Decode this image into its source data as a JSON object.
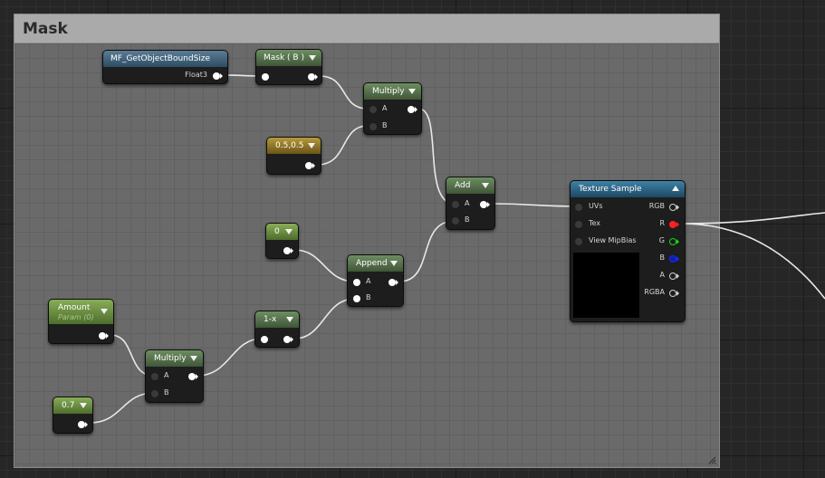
{
  "comment": {
    "title": "Mask"
  },
  "nodes": {
    "bound_size": {
      "title": "MF_GetObjectBoundSize",
      "out_label": "Float3"
    },
    "mask_b": {
      "title": "Mask ( B )"
    },
    "multiply_top": {
      "title": "Multiply",
      "a": "A",
      "b": "B"
    },
    "const_05": {
      "title": "0.5,0.5"
    },
    "add": {
      "title": "Add",
      "a": "A",
      "b": "B"
    },
    "const_0": {
      "title": "0"
    },
    "append": {
      "title": "Append",
      "a": "A",
      "b": "B"
    },
    "one_minus": {
      "title": "1-x"
    },
    "amount": {
      "title": "Amount",
      "subtitle": "Param (0)"
    },
    "multiply_bottom": {
      "title": "Multiply",
      "a": "A",
      "b": "B"
    },
    "const_07": {
      "title": "0.7"
    },
    "texture_sample": {
      "title": "Texture Sample",
      "inputs": [
        "UVs",
        "Tex",
        "View MipBias"
      ],
      "outputs": [
        "RGB",
        "R",
        "G",
        "B",
        "A",
        "RGBA"
      ]
    }
  },
  "colors": {
    "comment_header": "#aaaaaa",
    "wire": "#e8e8e8",
    "r_pin": "#ff2020",
    "g_pin": "#18d818",
    "b_pin": "#1828ff"
  }
}
